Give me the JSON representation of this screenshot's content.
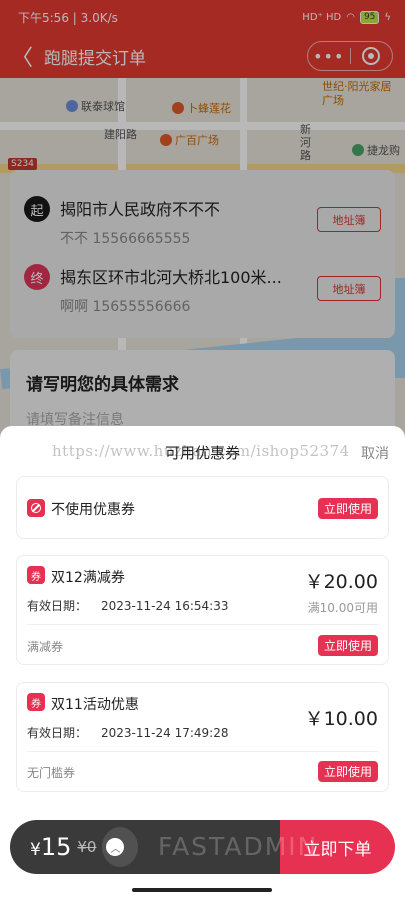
{
  "status_bar": {
    "time_text": "下午5:56 | 3.0K/s",
    "signal_text": "HD⁺ HD",
    "battery": "95"
  },
  "nav": {
    "back_glyph": "〈",
    "title": "跑腿提交订单",
    "more_glyph": "•••"
  },
  "map": {
    "pois": [
      "联泰球馆",
      "卜蜂莲花",
      "建阳路",
      "广百广场",
      "新河路",
      "世纪·阳光家居广场",
      "捷龙购"
    ],
    "road_shield": "S234"
  },
  "addresses": [
    {
      "badge": "起",
      "badge_color": "#1a1a1a",
      "name": "揭阳市人民政府不不不",
      "contact": "不不 15566665555",
      "book_label": "地址簿"
    },
    {
      "badge": "终",
      "badge_color": "#e0365a",
      "name": "揭东区环市北河大桥北100米...",
      "contact": "啊啊 15655556666",
      "book_label": "地址簿"
    }
  ],
  "requirement": {
    "title": "请写明您的具体需求",
    "placeholder": "请填写备注信息"
  },
  "coupon_sheet": {
    "watermark_url": "https://www.huzhan.com/ishop52374",
    "title": "可用优惠券",
    "cancel_label": "取消",
    "no_coupon": {
      "label": "不使用优惠券",
      "button": "立即使用"
    },
    "coupons": [
      {
        "icon_text": "券",
        "name": "双12满减券",
        "date_label": "有效日期：",
        "date": "2023-11-24 16:54:33",
        "amount": "￥20.00",
        "condition": "满10.00可用",
        "type": "满减券",
        "button": "立即使用"
      },
      {
        "icon_text": "券",
        "name": "双11活动优惠",
        "date_label": "有效日期：",
        "date": "2023-11-24 17:49:28",
        "amount": "￥10.00",
        "condition": "",
        "type": "无门槛券",
        "button": "立即使用"
      }
    ]
  },
  "bottom_bar": {
    "currency": "¥",
    "price": "15",
    "original_price": "¥0",
    "expand_glyph": "︿",
    "watermark": "FASTADMIN",
    "submit_label": "立即下单"
  },
  "colors": {
    "brand_red": "#e63b32",
    "accent_pink": "#e63152",
    "bar_dark": "#3a3a3a"
  }
}
